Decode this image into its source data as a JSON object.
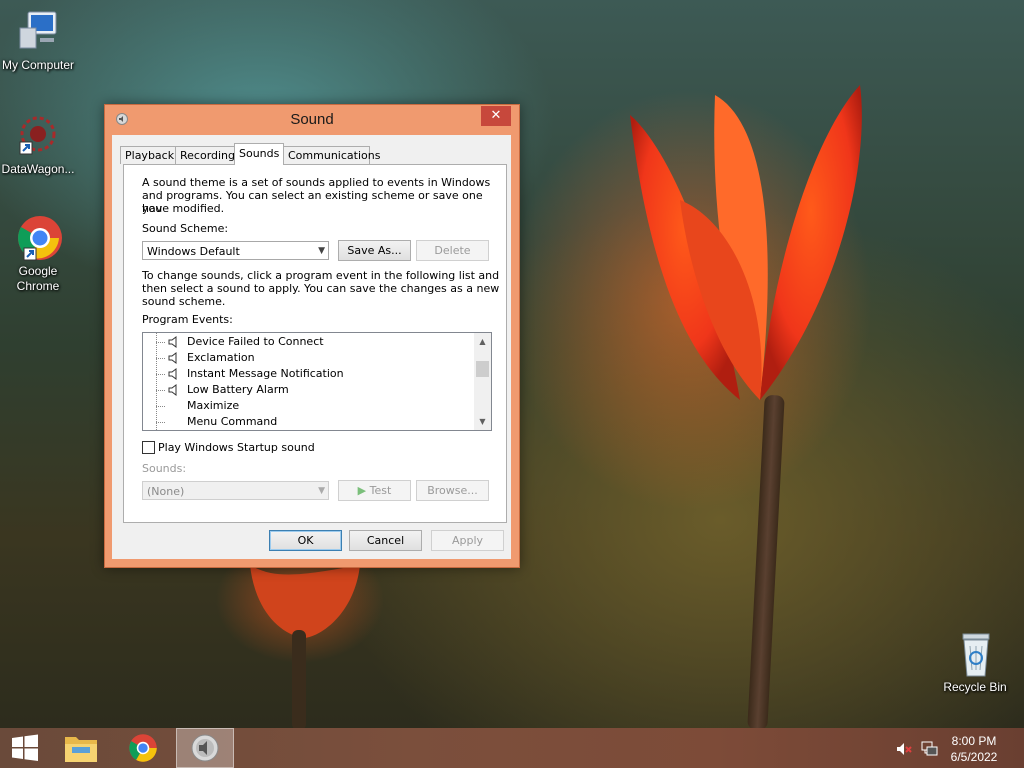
{
  "desktop": {
    "icons": [
      {
        "label": "My Computer"
      },
      {
        "label": "DataWagon..."
      },
      {
        "label": "Google\nChrome"
      },
      {
        "label": "Recycle Bin"
      }
    ]
  },
  "window": {
    "title": "Sound",
    "tabs": [
      {
        "label": "Playback"
      },
      {
        "label": "Recording"
      },
      {
        "label": "Sounds"
      },
      {
        "label": "Communications"
      }
    ],
    "active_tab": "Sounds",
    "intro_line1": "A sound theme is a set of sounds applied to events in Windows",
    "intro_line2": "and programs.  You can select an existing scheme or save one you",
    "intro_line3": "have modified.",
    "scheme_label": "Sound Scheme:",
    "scheme_value": "Windows Default",
    "save_as_label": "Save As...",
    "delete_label": "Delete",
    "change_line1": "To change sounds, click a program event in the following list and",
    "change_line2": "then select a sound to apply.  You can save the changes as a new",
    "change_line3": "sound scheme.",
    "events_label": "Program Events:",
    "events": [
      {
        "label": "Device Failed to Connect",
        "has_sound": true
      },
      {
        "label": "Exclamation",
        "has_sound": true
      },
      {
        "label": "Instant Message Notification",
        "has_sound": true
      },
      {
        "label": "Low Battery Alarm",
        "has_sound": true
      },
      {
        "label": "Maximize",
        "has_sound": false
      },
      {
        "label": "Menu Command",
        "has_sound": false
      }
    ],
    "startup_label": "Play Windows Startup sound",
    "startup_checked": false,
    "sounds_label": "Sounds:",
    "sounds_value": "(None)",
    "test_label": "Test",
    "browse_label": "Browse...",
    "ok_label": "OK",
    "cancel_label": "Cancel",
    "apply_label": "Apply"
  },
  "taskbar": {
    "items": [
      {
        "icon": "windows-start-icon"
      },
      {
        "icon": "file-explorer-icon"
      },
      {
        "icon": "chrome-icon"
      },
      {
        "icon": "sound-icon",
        "active": true
      }
    ],
    "time": "8:00 PM",
    "date": "6/5/2022"
  }
}
